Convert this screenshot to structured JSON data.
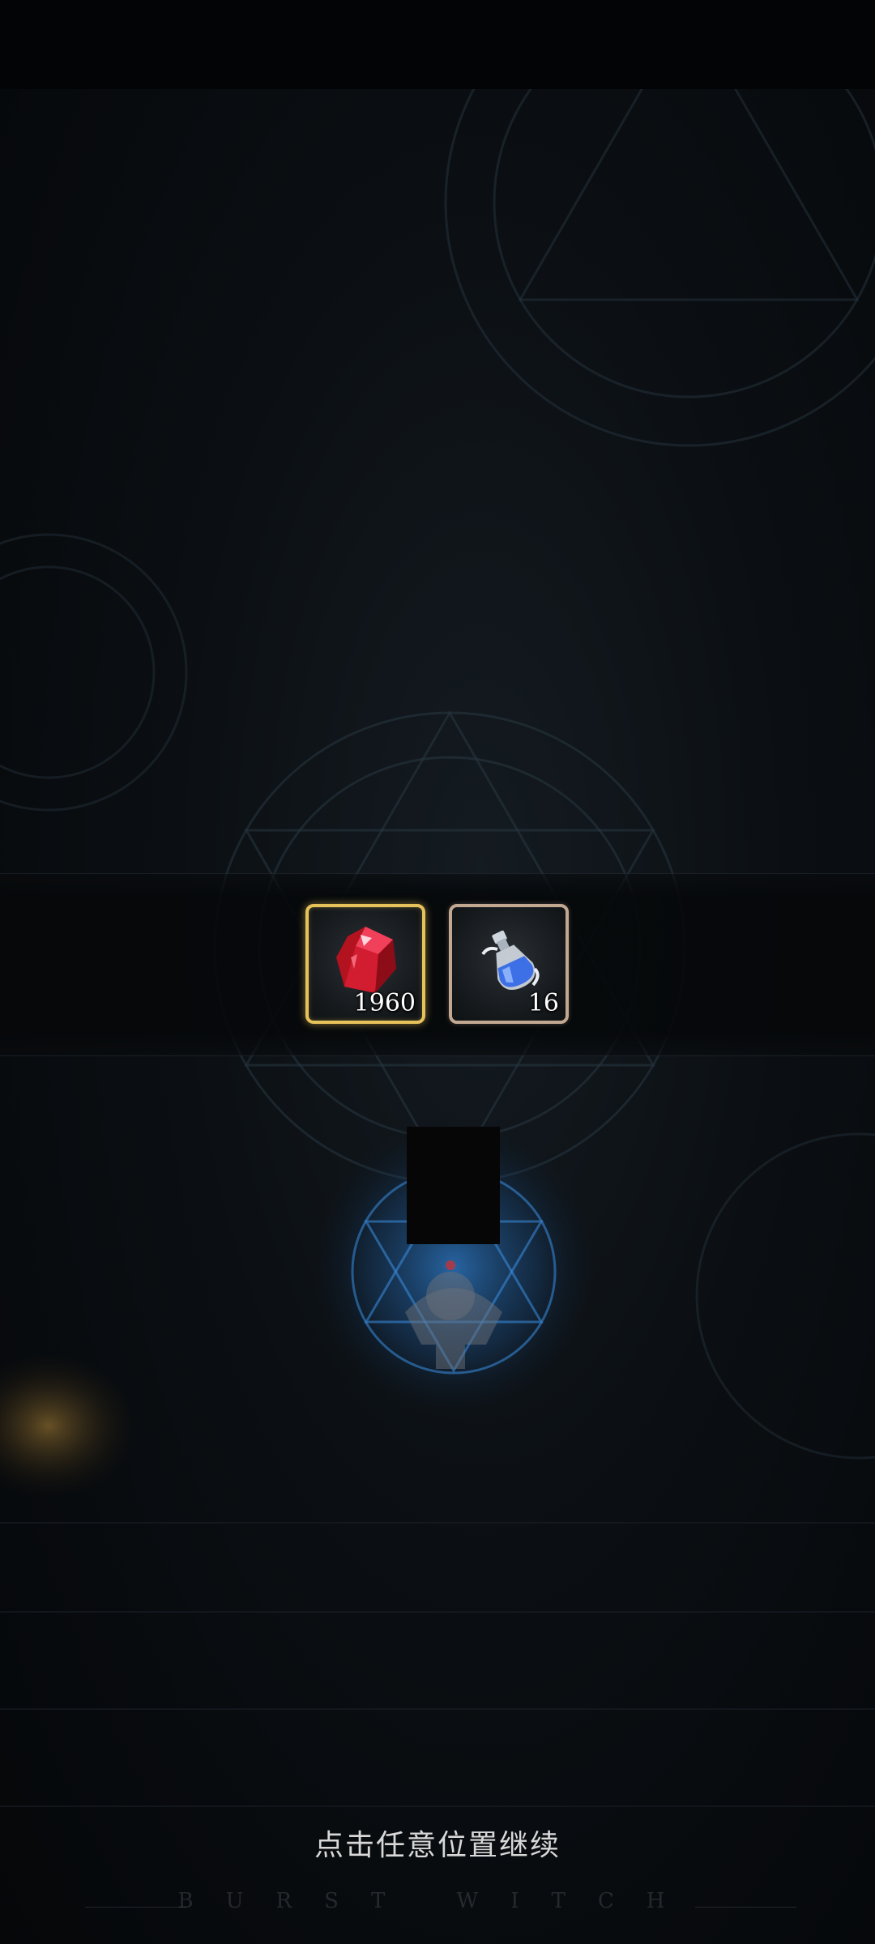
{
  "rewards": [
    {
      "icon": "red-crystal-icon",
      "count": "1960",
      "frame": "gold"
    },
    {
      "icon": "blue-potion-icon",
      "count": "16",
      "frame": "silver"
    }
  ],
  "continue_hint": "点击任意位置继续",
  "brand_text": "BURST WITCH",
  "colors": {
    "gold_frame": "#e6c25a",
    "silver_frame": "#c2a891",
    "magic_blue": "#2f7fd0"
  }
}
